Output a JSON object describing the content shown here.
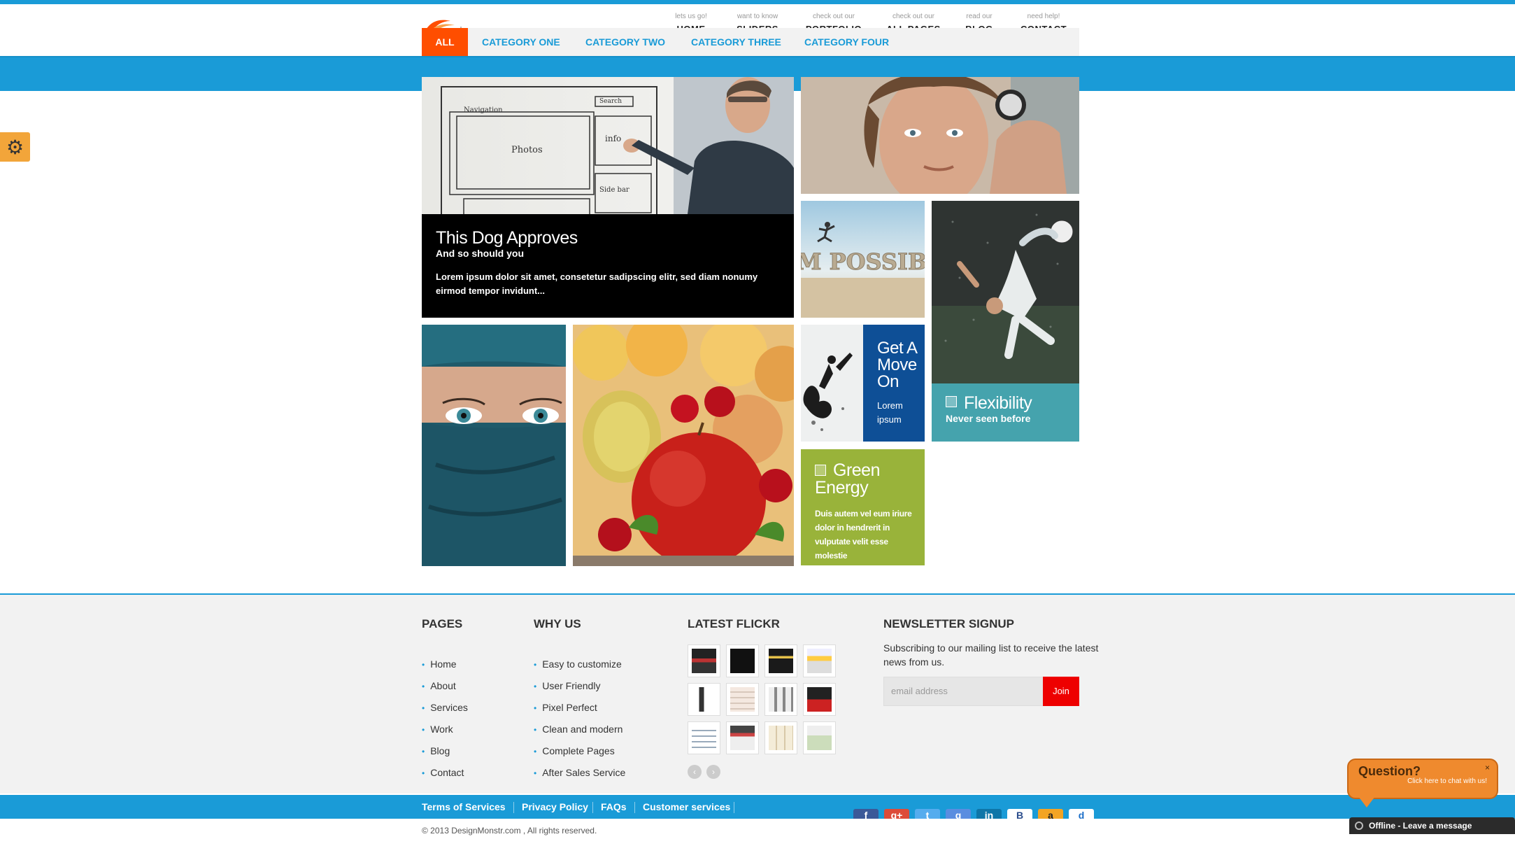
{
  "header": {
    "nav": [
      {
        "small": "lets us go!",
        "label": "HOME"
      },
      {
        "small": "want to know",
        "label": "SLIDERS"
      },
      {
        "small": "check out our",
        "label": "PORTFOLIO"
      },
      {
        "small": "check out our",
        "label": "ALL PAGES"
      },
      {
        "small": "read our",
        "label": "BLOG"
      },
      {
        "small": "need help!",
        "label": "CONTACT"
      }
    ]
  },
  "categories": [
    "ALL",
    "CATEGORY ONE",
    "CATEGORY TWO",
    "CATEGORY THREE",
    "CATEGORY FOUR"
  ],
  "tiles": {
    "dog": {
      "title": "This Dog Approves",
      "subtitle": "And so should you",
      "text": "Lorem ipsum dolor sit amet, consetetur sadipscing elitr, sed diam nonumy eirmod tempor invidunt..."
    },
    "move": {
      "title": "Get A Move On",
      "text": "Lorem ipsum"
    },
    "flex": {
      "title": "Flexibility",
      "subtitle": "Never seen before"
    },
    "green": {
      "title": "Green Energy",
      "text": "Duis autem vel eum iriure dolor in hendrerit in vulputate velit esse molestie"
    },
    "possible_text": "M POSSIBL"
  },
  "footer": {
    "pages_heading": "PAGES",
    "pages": [
      "Home",
      "About",
      "Services",
      "Work",
      "Blog",
      "Contact"
    ],
    "why_heading": "WHY US",
    "why": [
      "Easy to customize",
      "User Friendly",
      "Pixel Perfect",
      "Clean and modern",
      "Complete Pages",
      "After Sales Service"
    ],
    "flickr_heading": "LATEST FLICKR",
    "newsletter_heading": "NEWSLETTER SIGNUP",
    "newsletter_text": "Subscribing to our mailing list to receive the latest news from us.",
    "email_placeholder": "email address",
    "join_label": "Join"
  },
  "bottom": {
    "links": [
      "Terms of Services",
      "Privacy Policy",
      "FAQs",
      "Customer services"
    ],
    "copyright": "© 2013 DesignMonstr.com , All rights reserved.",
    "social": [
      "f",
      "g+",
      "t",
      "g",
      "in",
      "B",
      "a",
      "d"
    ]
  },
  "chat": {
    "question": "Question?",
    "sub": "Click here to chat with us!",
    "close": "×",
    "offline": "Offline - Leave a message"
  },
  "colors": {
    "accent_blue": "#1a9bd7",
    "accent_orange": "#ff4e00",
    "move_blue": "#0e4f96",
    "flex_teal": "#45a3ad",
    "green": "#99b33a",
    "join_red": "#ee0000"
  }
}
